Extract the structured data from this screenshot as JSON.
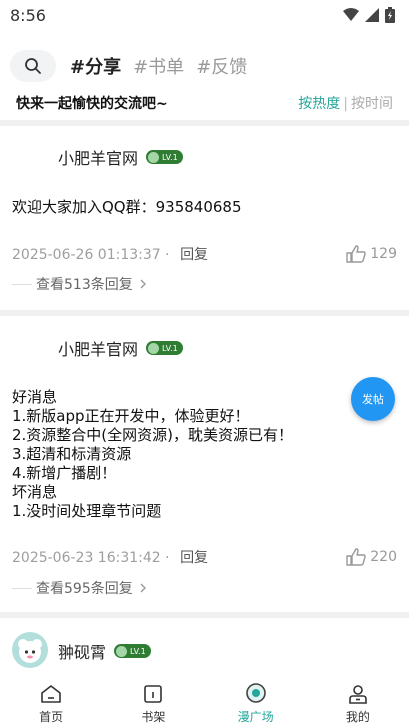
{
  "status_bar": {
    "time": "8:56"
  },
  "header": {
    "tabs": [
      {
        "label": "#分享",
        "active": true
      },
      {
        "label": "#书单",
        "active": false
      },
      {
        "label": "#反馈",
        "active": false
      }
    ]
  },
  "subheader": {
    "title": "快来一起愉快的交流吧~",
    "sort_hot": "按热度",
    "sort_sep": "|",
    "sort_time": "按时间"
  },
  "posts": [
    {
      "author": "小肥羊官网",
      "level": "LV.1",
      "body": "欢迎大家加入QQ群：935840685",
      "date": "2025-06-26 01:13:37",
      "dot": "·",
      "reply": "回复",
      "likes": "129",
      "view_replies": "查看513条回复"
    },
    {
      "author": "小肥羊官网",
      "level": "LV.1",
      "body": "好消息\n1.新版app正在开发中，体验更好！\n2.资源整合中(全网资源)，耽美资源已有！\n3.超清和标清资源\n4.新增广播剧！\n坏消息\n1.没时间处理章节问题",
      "date": "2025-06-23 16:31:42",
      "dot": "·",
      "reply": "回复",
      "likes": "220",
      "view_replies": "查看595条回复"
    },
    {
      "author": "翀砚霄",
      "level": "LV.1"
    }
  ],
  "float_button": {
    "label": "发帖"
  },
  "bottom_nav": [
    {
      "label": "首页",
      "icon": "home-icon"
    },
    {
      "label": "书架",
      "icon": "bookshelf-icon"
    },
    {
      "label": "漫广场",
      "icon": "plaza-icon"
    },
    {
      "label": "我的",
      "icon": "profile-icon"
    }
  ],
  "colors": {
    "accent": "#26a69a",
    "badge": "#2e7d32",
    "fab": "#2196f3"
  }
}
